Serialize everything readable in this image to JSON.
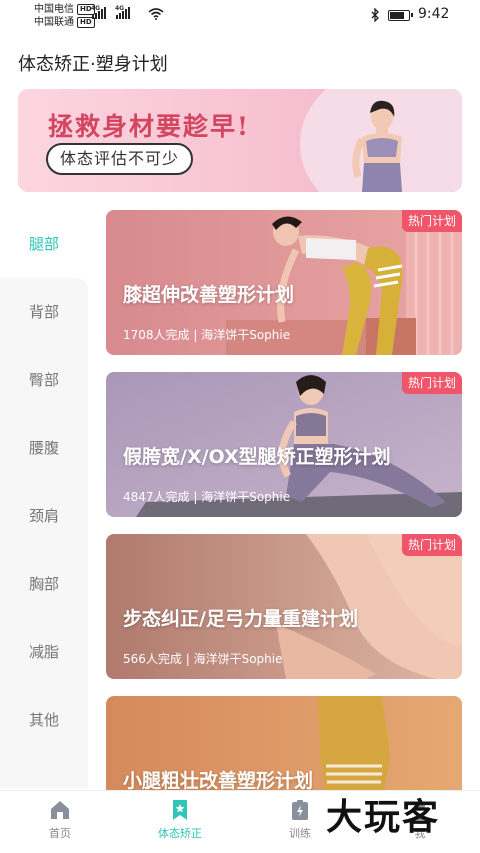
{
  "status_bar": {
    "carrier_1": "中国电信",
    "carrier_2": "中国联通",
    "hd_badge": "HD",
    "network_type": "4G",
    "time": "9:42",
    "battery_level": 0.8
  },
  "header": {
    "title": "体态矫正·塑身计划"
  },
  "banner": {
    "headline": "拯救身材要趁早!",
    "subline": "体态评估不可少"
  },
  "sidebar": {
    "items": [
      {
        "label": "腿部"
      },
      {
        "label": "背部"
      },
      {
        "label": "臀部"
      },
      {
        "label": "腰腹"
      },
      {
        "label": "颈肩"
      },
      {
        "label": "胸部"
      },
      {
        "label": "减脂"
      },
      {
        "label": "其他"
      }
    ],
    "active_index": 0,
    "accent_color": "#2ec4b6"
  },
  "plans": [
    {
      "badge": "热门计划",
      "title": "膝超伸改善塑形计划",
      "meta": "1708人完成 | 海洋饼干Sophie"
    },
    {
      "badge": "热门计划",
      "title": "假胯宽/X/OX型腿矫正塑形计划",
      "meta": "4847人完成 | 海洋饼干Sophie"
    },
    {
      "badge": "热门计划",
      "title": "步态纠正/足弓力量重建计划",
      "meta": "566人完成 | 海洋饼干Sophie"
    },
    {
      "badge": "",
      "title": "小腿粗壮改善塑形计划",
      "meta": ""
    }
  ],
  "bottom_nav": {
    "items": [
      {
        "label": "首页",
        "icon": "home-icon"
      },
      {
        "label": "体态矫正",
        "icon": "bookmark-star-icon"
      },
      {
        "label": "训练",
        "icon": "training-icon"
      },
      {
        "label": "我",
        "icon": "profile-icon"
      }
    ],
    "active_index": 1
  },
  "watermark": {
    "text": "大玩客"
  },
  "colors": {
    "accent": "#2ec4b6",
    "badge": "#f0566a",
    "banner_text": "#d4455f"
  }
}
